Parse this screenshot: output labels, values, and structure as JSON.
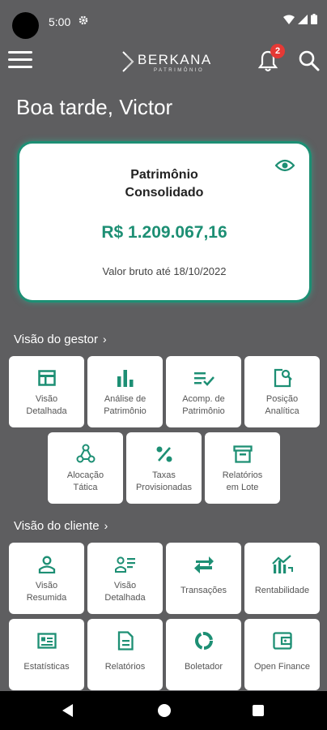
{
  "status_bar": {
    "time": "5:00"
  },
  "app_bar": {
    "logo_text": "BERKANA",
    "logo_subtitle": "PATRIMÔNIO",
    "notification_count": "2"
  },
  "greeting": "Boa tarde, Victor",
  "card": {
    "title_line1": "Patrimônio",
    "title_line2": "Consolidado",
    "value": "R$ 1.209.067,16",
    "date_text": "Valor bruto até 18/10/2022"
  },
  "sections": {
    "gestor": {
      "title": "Visão do gestor",
      "tiles": [
        {
          "line1": "Visão",
          "line2": "Detalhada",
          "icon": "table-icon"
        },
        {
          "line1": "Análise de",
          "line2": "Patrimônio",
          "icon": "bar-chart-icon"
        },
        {
          "line1": "Acomp. de",
          "line2": "Patrimônio",
          "icon": "checklist-icon"
        },
        {
          "line1": "Posição",
          "line2": "Analítica",
          "icon": "document-search-icon"
        },
        {
          "line1": "Alocação",
          "line2": "Tática",
          "icon": "hierarchy-icon"
        },
        {
          "line1": "Taxas",
          "line2": "Provisionadas",
          "icon": "percent-icon"
        },
        {
          "line1": "Relatórios",
          "line2": "em Lote",
          "icon": "archive-icon"
        }
      ]
    },
    "cliente": {
      "title": "Visão do cliente",
      "tiles": [
        {
          "line1": "Visão",
          "line2": "Resumida",
          "icon": "person-icon"
        },
        {
          "line1": "Visão",
          "line2": "Detalhada",
          "icon": "person-list-icon"
        },
        {
          "line1": "Transações",
          "line2": "",
          "icon": "swap-arrows-icon"
        },
        {
          "line1": "Rentabilidade",
          "line2": "",
          "icon": "growth-chart-icon"
        },
        {
          "line1": "Estatísticas",
          "line2": "",
          "icon": "stats-card-icon"
        },
        {
          "line1": "Relatórios",
          "line2": "",
          "icon": "report-doc-icon"
        },
        {
          "line1": "Boletador",
          "line2": "",
          "icon": "donut-icon"
        },
        {
          "line1": "Open Finance",
          "line2": "",
          "icon": "wallet-icon"
        }
      ]
    }
  },
  "colors": {
    "accent": "#1d8f74",
    "background": "#5e5e60",
    "badge": "#e53935"
  }
}
